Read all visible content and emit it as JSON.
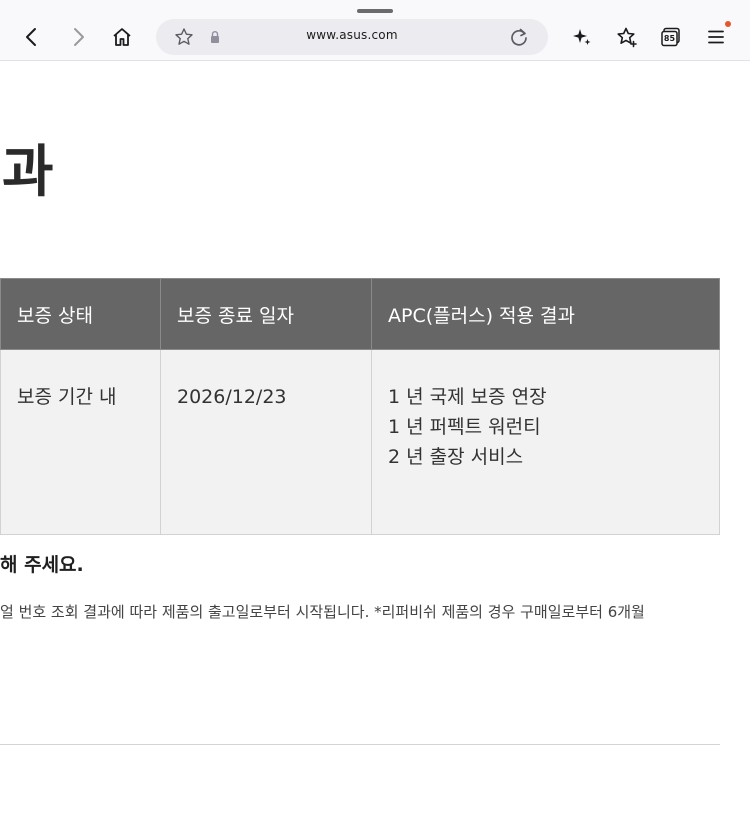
{
  "browser": {
    "url": "www.asus.com",
    "icons": [
      "back-icon",
      "forward-icon",
      "home-icon",
      "bookmark-star-icon",
      "lock-icon",
      "reload-icon",
      "sparkle-icon",
      "favorites-icon",
      "tabs-icon",
      "menu-icon"
    ],
    "tab_count": "85",
    "accent_dot_color": "#e4572e"
  },
  "page": {
    "heading": "과",
    "table": {
      "headers": [
        "보증 상태",
        "보증 종료 일자",
        "APC(플러스) 적용 결과"
      ],
      "row": {
        "status": "보증 기간 내",
        "end_date": "2026/12/23",
        "results": [
          "1 년 국제 보증 연장",
          "1 년 퍼펙트 워런티",
          "2 년 출장 서비스"
        ]
      },
      "header_bg": "#666666",
      "cell_bg": "#f2f2f2"
    },
    "notice_title": "해 주세요.",
    "notice_body": "얼 번호 조회 결과에 따라 제품의 출고일로부터 시작됩니다. *리퍼비쉬 제품의 경우 구매일로부터 6개월"
  }
}
